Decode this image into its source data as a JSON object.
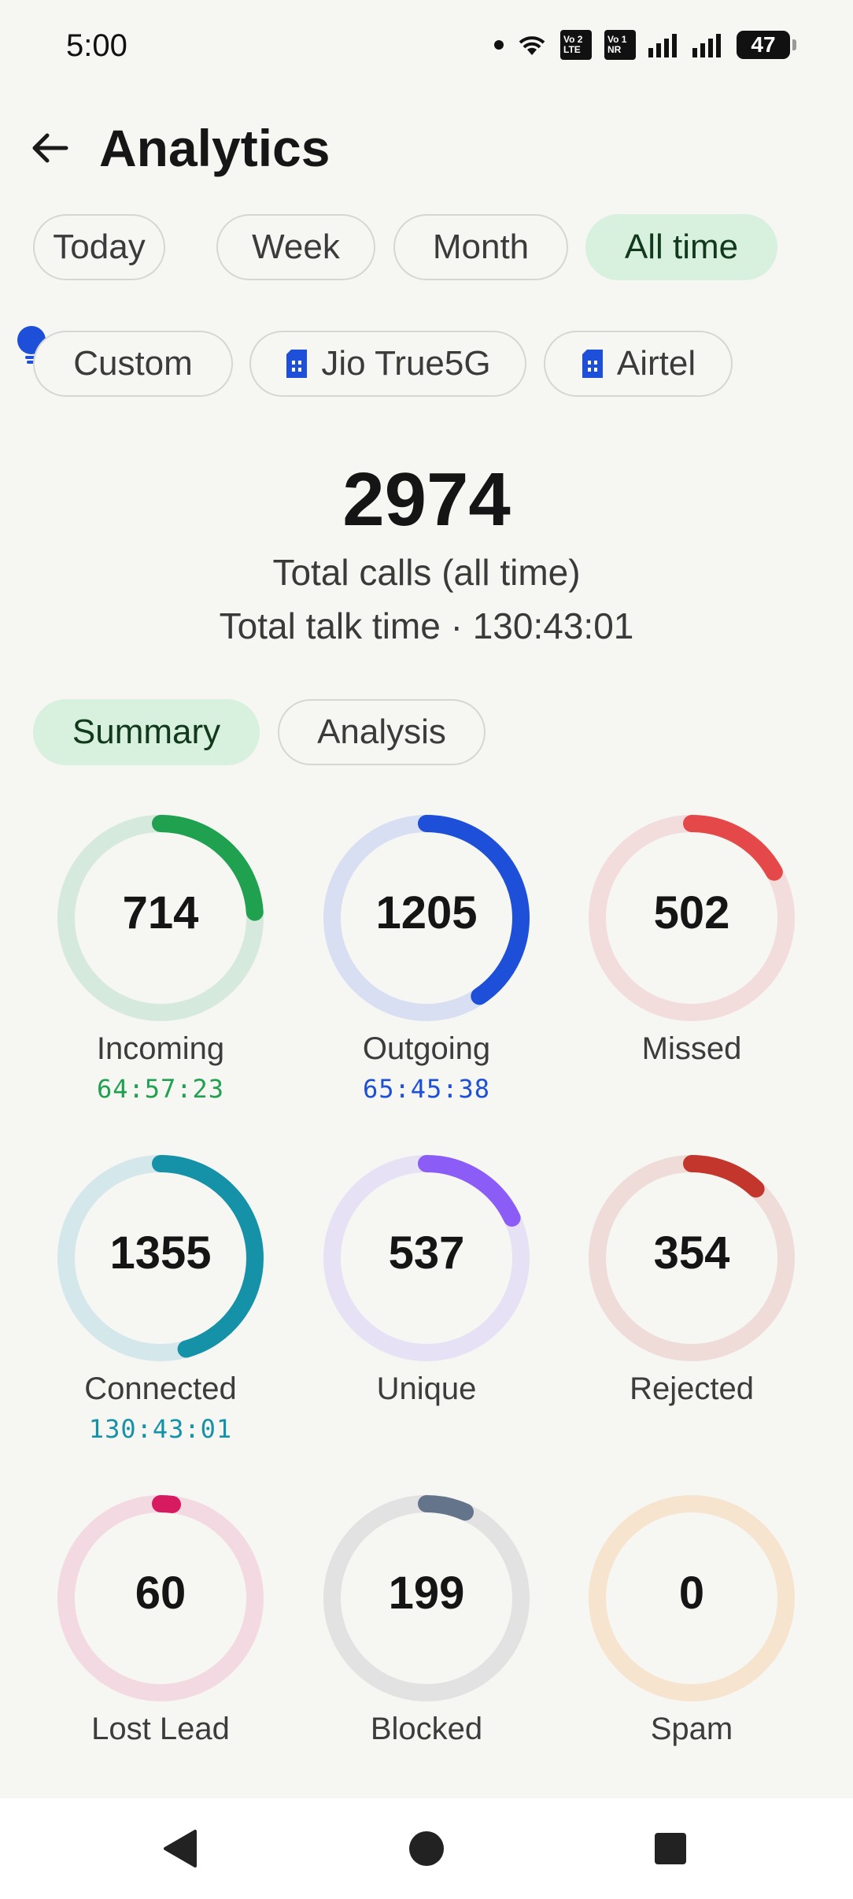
{
  "status_bar": {
    "time": "5:00",
    "sim1": {
      "line1": "Vo 2",
      "line2": "LTE"
    },
    "sim2": {
      "line1": "Vo 1",
      "line2": "NR"
    },
    "battery": "47"
  },
  "header": {
    "title": "Analytics"
  },
  "range_filters": [
    "Today",
    "Week",
    "Month",
    "All time"
  ],
  "range_selected": "All time",
  "filters2": {
    "custom": "Custom",
    "sim_a": "Jio True5G",
    "sim_b": "Airtel"
  },
  "totals": {
    "count": "2974",
    "label": "Total calls (all time)",
    "talk_time": "Total talk time · 130:43:01"
  },
  "tabs": {
    "summary": "Summary",
    "analysis": "Analysis",
    "selected": "Summary"
  },
  "stats": [
    {
      "value": "714",
      "label": "Incoming",
      "sub": "64:57:23",
      "fraction": 0.24,
      "color": "#1fa150",
      "track": "#d6e9dd",
      "sub_color": "#1fa150"
    },
    {
      "value": "1205",
      "label": "Outgoing",
      "sub": "65:45:38",
      "fraction": 0.405,
      "color": "#1d4fd8",
      "track": "#d8dff2",
      "sub_color": "#1d4fd8"
    },
    {
      "value": "502",
      "label": "Missed",
      "sub": "",
      "fraction": 0.169,
      "color": "#e54848",
      "track": "#f3dcdc",
      "sub_color": "#e54848"
    },
    {
      "value": "1355",
      "label": "Connected",
      "sub": "130:43:01",
      "fraction": 0.456,
      "color": "#1592a8",
      "track": "#d4e7ea",
      "sub_color": "#1592a8"
    },
    {
      "value": "537",
      "label": "Unique",
      "sub": "",
      "fraction": 0.18,
      "color": "#8b5cf6",
      "track": "#e7e1f6",
      "sub_color": "#8b5cf6"
    },
    {
      "value": "354",
      "label": "Rejected",
      "sub": "",
      "fraction": 0.119,
      "color": "#c2362b",
      "track": "#efdcd9",
      "sub_color": "#c2362b"
    },
    {
      "value": "60",
      "label": "Lost Lead",
      "sub": "",
      "fraction": 0.02,
      "color": "#d81b60",
      "track": "#f3d9e2",
      "sub_color": "#d81b60"
    },
    {
      "value": "199",
      "label": "Blocked",
      "sub": "",
      "fraction": 0.067,
      "color": "#64748b",
      "track": "#e2e2e3",
      "sub_color": "#64748b"
    },
    {
      "value": "0",
      "label": "Spam",
      "sub": "",
      "fraction": 0.0,
      "color": "#f59e0b",
      "track": "#f6e4cf",
      "sub_color": "#f59e0b"
    }
  ]
}
